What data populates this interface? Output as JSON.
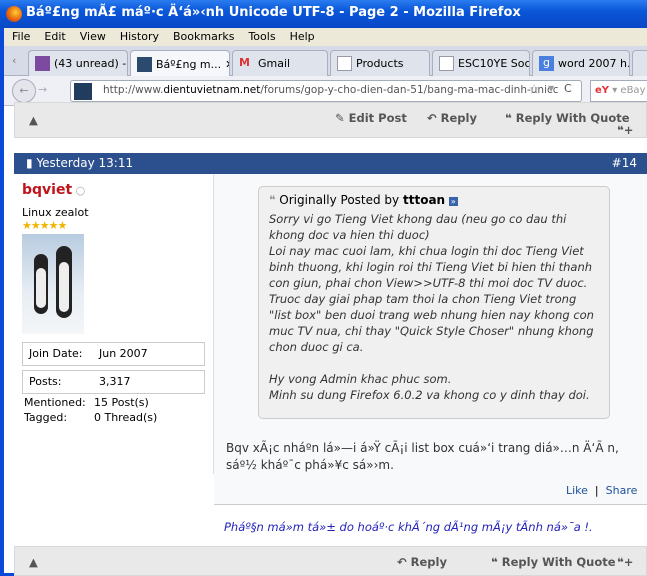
{
  "window": {
    "title": "Báº£ng mÃ£ máº·c Ä‘á»‹nh Unicode UTF-8 - Page 2 - Mozilla Firefox"
  },
  "menu": [
    "File",
    "Edit",
    "View",
    "History",
    "Bookmarks",
    "Tools",
    "Help"
  ],
  "tabs": [
    {
      "label": "(43 unread) -..."
    },
    {
      "label": "Báº£ng m...",
      "active": true
    },
    {
      "label": "Gmail"
    },
    {
      "label": "Products"
    },
    {
      "label": "ESC10YE Soc..."
    },
    {
      "label": "word 2007 h..."
    }
  ],
  "nav": {
    "url_prefix": "http://www.",
    "url_domain": "dientuvietnam.net",
    "url_path": "/forums/gop-y-cho-dien-dan-51/bang-ma-mac-dinh-unicc",
    "search_placeholder": "eBay"
  },
  "top_toolbar": {
    "edit": "Edit Post",
    "reply": "Reply",
    "reply_quote": "Reply With Quote"
  },
  "post": {
    "date": "Yesterday 13:11",
    "number": "#14",
    "user": {
      "name": "bqviet",
      "title": "Linux zealot",
      "join_label": "Join Date:",
      "join": "Jun 2007",
      "posts_label": "Posts:",
      "posts": "3,317",
      "mentioned_label": "Mentioned:",
      "mentioned": "15 Post(s)",
      "tagged_label": "Tagged:",
      "tagged": "0 Thread(s)"
    },
    "quote": {
      "prefix": "Originally Posted by",
      "author": "tttoan",
      "text": "Sorry vi go Tieng Viet khong dau (neu go co dau thi khong doc va hien thi duoc)\nLoi nay mac cuoi lam, khi chua login thi doc Tieng Viet binh thuong, khi login roi thi Tieng Viet bi hien thi thanh con giun, phai chon View>>UTF-8 thi moi doc TV duoc. Truoc day giai phap tam thoi la chon Tieng Viet trong \"list box\" ben duoi trang web nhung hien nay khong con muc TV nua, chi thay \"Quick Style Choser\" nhung khong chon duoc gi ca.\n\nHy vong Admin khac phuc som.\nMinh su dung Firefox 6.0.2 va khong co y dinh thay doi."
    },
    "body": "Bqv xÃ¡c nháº­n lá»—i á»Ÿ cÃ¡i list box cuá»‘i trang diá»…n Ä‘Ã n, sáº½ kháº¯c phá»¥c sá»›m.",
    "like": "Like",
    "share": "Share",
    "signature": "Pháº§n má»m tá»± do hoáº·c khÃ´ng dÃ¹ng mÃ¡y tÃ­nh ná»¯a !.",
    "reply": "Reply",
    "reply_quote": "Reply With Quote"
  }
}
